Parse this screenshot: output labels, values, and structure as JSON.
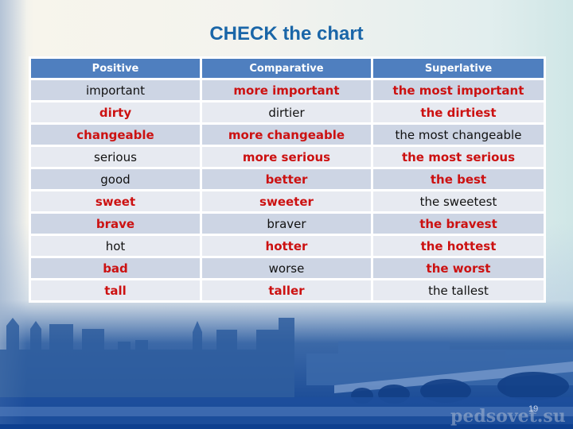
{
  "slide": {
    "title": "CHECK the chart",
    "page_number": "19",
    "watermark": "pedsovet.su"
  },
  "colors": {
    "title": "#1a66a8",
    "header_bg": "#4f7fbf",
    "row_odd": "#cdd5e4",
    "row_even": "#e7eaf1",
    "highlight_text": "#cc1111"
  },
  "table": {
    "headers": [
      "Positive",
      "Comparative",
      "Superlative"
    ],
    "rows": [
      {
        "cells": [
          {
            "text": "important",
            "red": false
          },
          {
            "text": "more important",
            "red": true
          },
          {
            "text": "the most important",
            "red": true
          }
        ]
      },
      {
        "cells": [
          {
            "text": "dirty",
            "red": true
          },
          {
            "text": "dirtier",
            "red": false
          },
          {
            "text": "the dirtiest",
            "red": true
          }
        ]
      },
      {
        "cells": [
          {
            "text": "changeable",
            "red": true
          },
          {
            "text": "more changeable",
            "red": true
          },
          {
            "text": "the most changeable",
            "red": false
          }
        ]
      },
      {
        "cells": [
          {
            "text": "serious",
            "red": false
          },
          {
            "text": "more serious",
            "red": true
          },
          {
            "text": "the most serious",
            "red": true
          }
        ]
      },
      {
        "cells": [
          {
            "text": "good",
            "red": false
          },
          {
            "text": "better",
            "red": true
          },
          {
            "text": "the best",
            "red": true
          }
        ]
      },
      {
        "cells": [
          {
            "text": "sweet",
            "red": true
          },
          {
            "text": "sweeter",
            "red": true
          },
          {
            "text": "the sweetest",
            "red": false
          }
        ]
      },
      {
        "cells": [
          {
            "text": "brave",
            "red": true
          },
          {
            "text": "braver",
            "red": false
          },
          {
            "text": "the bravest",
            "red": true
          }
        ]
      },
      {
        "cells": [
          {
            "text": "hot",
            "red": false
          },
          {
            "text": "hotter",
            "red": true
          },
          {
            "text": "the hottest",
            "red": true
          }
        ]
      },
      {
        "cells": [
          {
            "text": "bad",
            "red": true
          },
          {
            "text": "worse",
            "red": false
          },
          {
            "text": "the worst",
            "red": true
          }
        ]
      },
      {
        "cells": [
          {
            "text": "tall",
            "red": true
          },
          {
            "text": "taller",
            "red": true
          },
          {
            "text": "the tallest",
            "red": false
          }
        ]
      }
    ]
  },
  "background": {
    "image": "london-skyline-westminster-bridge-icon"
  }
}
